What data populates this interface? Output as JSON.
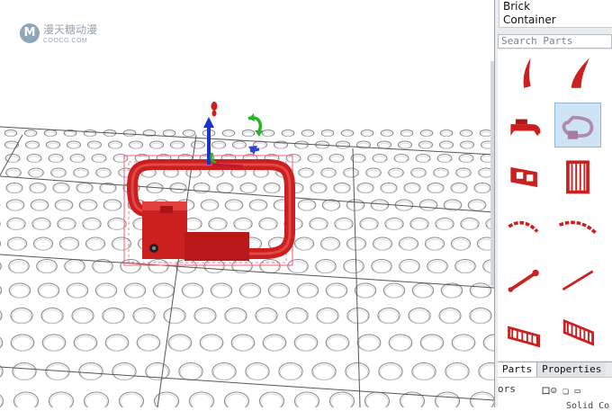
{
  "watermark": {
    "logo_letter": "M",
    "site_name": "漫天糖动漫",
    "site_url": "COOCG.COM"
  },
  "colors": {
    "brick_red": "#cc1f1f",
    "selection_outline": "#ff5a78",
    "axis_y": "#1a33c8",
    "axis_rotate": "#28b428",
    "selected_tile": "#cfe3f6"
  },
  "sidebar": {
    "categories": [
      {
        "label": "Brick"
      },
      {
        "label": "Container"
      }
    ],
    "search": {
      "placeholder": "Search Parts",
      "value": ""
    },
    "parts": [
      {
        "icon": "horn-icon"
      },
      {
        "icon": "curved-horn-icon"
      },
      {
        "icon": "handle-bracket-icon"
      },
      {
        "icon": "bar-handle-loop-icon",
        "selected": true
      },
      {
        "icon": "window-frame-icon"
      },
      {
        "icon": "fence-gate-icon"
      },
      {
        "icon": "chain-curve-icon"
      },
      {
        "icon": "chain-curve-long-icon"
      },
      {
        "icon": "rod-pin-icon"
      },
      {
        "icon": "long-rod-icon"
      },
      {
        "icon": "barrier-fence-icon"
      },
      {
        "icon": "barrier-fence-angled-icon"
      },
      {
        "icon": "half-part-icon"
      }
    ],
    "tabs": [
      {
        "label": "Parts",
        "active": true
      },
      {
        "label": "Properties",
        "active": false
      }
    ],
    "properties": {
      "key": "ors",
      "value": "ロ☺ ❏ ▭",
      "row2": "Solid Co"
    }
  }
}
